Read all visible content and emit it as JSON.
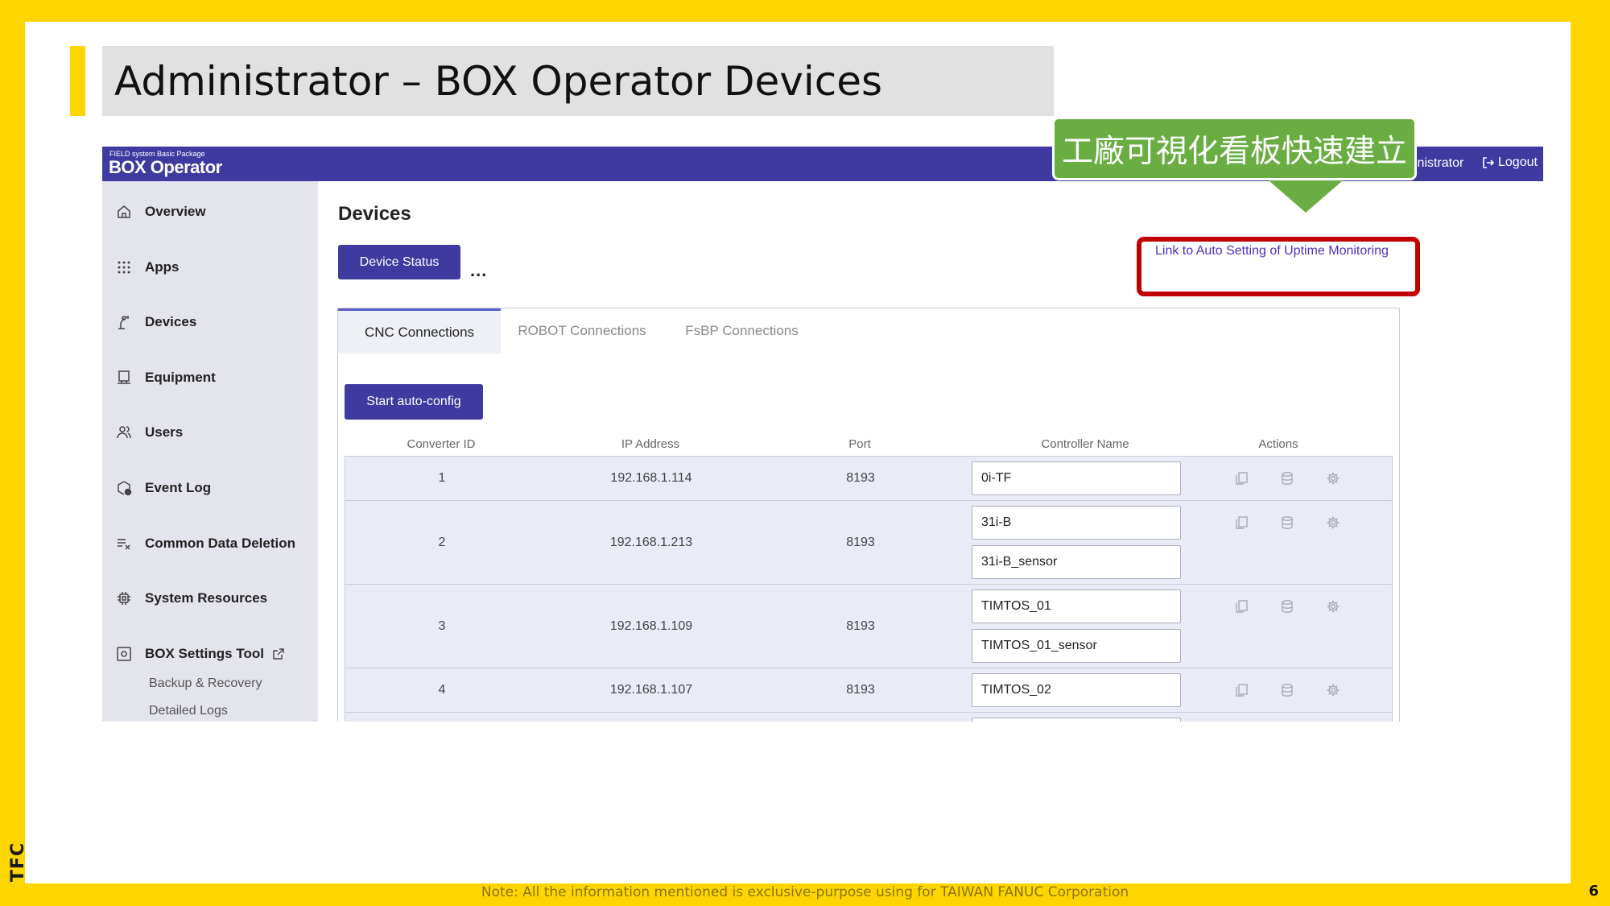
{
  "slide": {
    "title": "Administrator – BOX Operator Devices",
    "logo_text": "TFC",
    "footer_note": "Note: All the information mentioned is exclusive-purpose using for TAIWAN FANUC Corporation",
    "page_number": "6",
    "callout_text": "工廠可視化看板快速建立"
  },
  "header": {
    "brand_small": "FIELD system Basic Package",
    "brand_name": "BOX Operator",
    "user_partial": "inistrator",
    "logout_label": "Logout"
  },
  "sidebar": {
    "items": [
      {
        "label": "Overview",
        "icon": "home-icon"
      },
      {
        "label": "Apps",
        "icon": "grid-icon"
      },
      {
        "label": "Devices",
        "icon": "robot-arm-icon"
      },
      {
        "label": "Equipment",
        "icon": "monitor-icon"
      },
      {
        "label": "Users",
        "icon": "users-icon"
      },
      {
        "label": "Event Log",
        "icon": "event-log-icon"
      },
      {
        "label": "Common Data Deletion",
        "icon": "clear-list-icon"
      },
      {
        "label": "System Resources",
        "icon": "chip-icon"
      },
      {
        "label": "BOX Settings Tool",
        "icon": "settings-box-icon"
      }
    ],
    "sub_items": [
      "Backup & Recovery",
      "Detailed Logs"
    ]
  },
  "main": {
    "heading": "Devices",
    "device_status_button": "Device Status",
    "more_label": "...",
    "auto_setting_link": "Link to Auto Setting of Uptime Monitoring",
    "tabs": [
      "CNC Connections",
      "ROBOT Connections",
      "FsBP Connections"
    ],
    "start_autoconfig_button": "Start auto-config",
    "columns": [
      "Converter ID",
      "IP Address",
      "Port",
      "Controller Name",
      "Actions"
    ],
    "rows": [
      {
        "id": "1",
        "ip": "192.168.1.114",
        "port": "8193",
        "names": [
          "0i-TF"
        ]
      },
      {
        "id": "2",
        "ip": "192.168.1.213",
        "port": "8193",
        "names": [
          "31i-B",
          "31i-B_sensor"
        ]
      },
      {
        "id": "3",
        "ip": "192.168.1.109",
        "port": "8193",
        "names": [
          "TIMTOS_01",
          "TIMTOS_01_sensor"
        ]
      },
      {
        "id": "4",
        "ip": "192.168.1.107",
        "port": "8193",
        "names": [
          "TIMTOS_02"
        ]
      }
    ]
  },
  "colors": {
    "slide_yellow": "#FFD500",
    "header_purple": "#3f3aa0",
    "callout_green": "#6aad43",
    "highlight_red": "#c00000",
    "link_purple": "#4b2fc2"
  }
}
